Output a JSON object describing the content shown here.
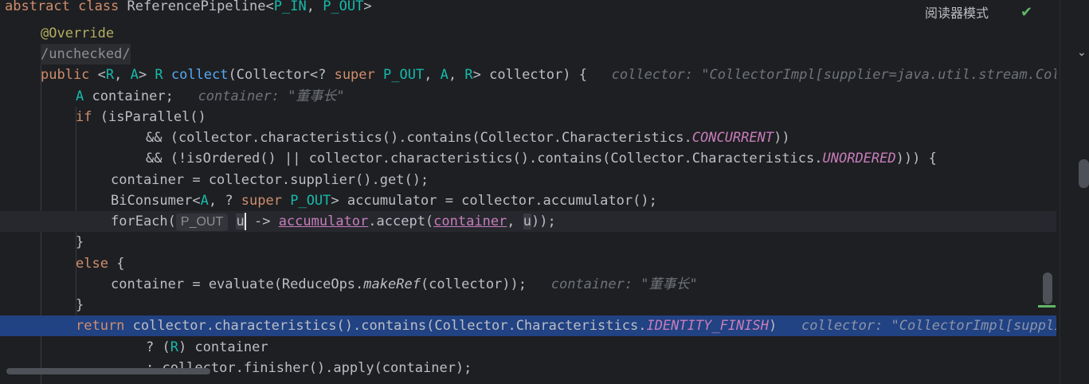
{
  "header": {
    "class_decl": {
      "kw": "abstract class ",
      "name": "ReferencePipeline<",
      "p_in": "P_IN",
      "comma": ", ",
      "p_out": "P_OUT",
      "close": ">"
    },
    "reader_mode_label": "阅读器模式",
    "check_icon": "check-icon"
  },
  "code": {
    "override": "@Override",
    "suppress": "/unchecked/",
    "sig": {
      "kw_public": "public ",
      "gen_open": "<",
      "R": "R",
      "comma1": ", ",
      "A": "A",
      "gen_close": "> ",
      "R2": "R ",
      "name": "collect",
      "params1": "(Collector<? ",
      "kw_super": "super ",
      "p_out": "P_OUT",
      "comma2": ", ",
      "A2": "A",
      "comma3": ", ",
      "R3": "R",
      "params2": "> collector) {",
      "hint": "collector: \"CollectorImpl[supplier=java.util.stream.Collectors$$Lambda"
    },
    "l_container": {
      "A": "A",
      "rest": " container;",
      "hint": "container: \"董事长\""
    },
    "l_if": {
      "kw": "if",
      "rest": " (isParallel()"
    },
    "l_and1": {
      "a": "&& (collector.characteristics().contains(Collector.Characteristics.",
      "cst": "CONCURRENT",
      "b": "))"
    },
    "l_and2": {
      "a": "&& (!isOrdered() || collector.characteristics().contains(Collector.Characteristics.",
      "cst": "UNORDERED",
      "b": "))) {"
    },
    "l_supplier": "container = collector.supplier().get();",
    "l_biconsumer": {
      "a": "BiConsumer<",
      "A": "A",
      "b": ", ? ",
      "kw_super": "super ",
      "p_out": "P_OUT",
      "c": "> accumulator = collector.accumulator();"
    },
    "l_foreach": {
      "a": "forEach(",
      "inlay": "P_OUT",
      "u": "u",
      "b": " -> ",
      "acc": "accumulator",
      "c": ".accept(",
      "cont": "container",
      "d": ", ",
      "u2": "u",
      "e": "));"
    },
    "l_close1": "}",
    "l_else": {
      "kw": "else",
      "rest": " {"
    },
    "l_evaluate": {
      "a": "container = evaluate(ReduceOps.",
      "fn": "makeRef",
      "b": "(collector));",
      "hint": "container: \"董事长\""
    },
    "l_close2": "}",
    "l_return": {
      "kw": "return",
      "a": " collector.characteristics().contains(Collector.Characteristics.",
      "cst": "IDENTITY_FINISH",
      "b": ")",
      "hint": "collector: \"CollectorImpl[supplier=java.util.stream"
    },
    "l_ternary1": {
      "a": "? (",
      "R": "R",
      "b": ") container"
    },
    "l_ternary2": ": collector.finisher().apply(container);"
  },
  "colors": {
    "background": "#1e1f22",
    "keyword": "#cf8e6d",
    "annotation": "#b3ae60",
    "function": "#56a8f5",
    "type_param": "#16baac",
    "constant": "#c77dbb",
    "execution_line": "#214283"
  }
}
